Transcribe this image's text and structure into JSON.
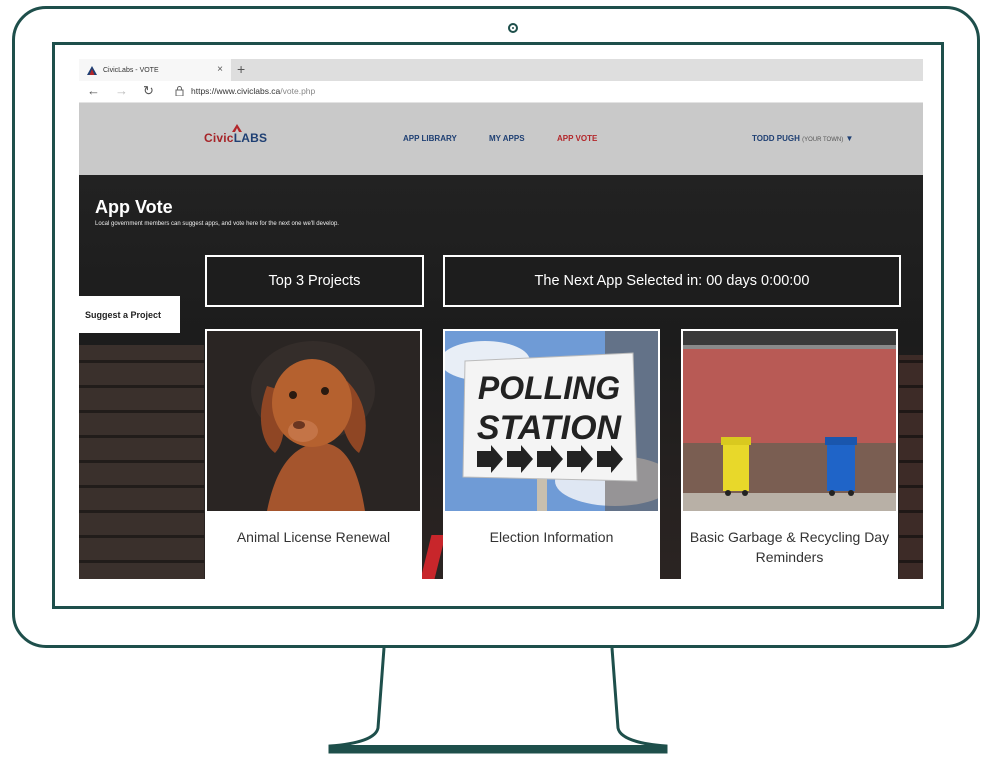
{
  "browser": {
    "tab_title": "CivicLabs - VOTE",
    "tab_close": "×",
    "new_tab": "+",
    "back": "←",
    "forward": "→",
    "reload": "↻",
    "url_host": "https://www.civiclabs.ca",
    "url_path": "/vote.php"
  },
  "header": {
    "brand_civic": "Civic",
    "brand_labs": "LABS",
    "nav": [
      {
        "label": "APP LIBRARY"
      },
      {
        "label": "MY APPS"
      },
      {
        "label": "APP VOTE"
      }
    ],
    "user_name": "TODD PUGH",
    "user_town": "(YOUR TOWN)",
    "user_caret": "▼"
  },
  "hero": {
    "title": "App Vote",
    "subtitle": "Local government members can suggest apps, and vote here for the next one we'll develop.",
    "top_projects": "Top 3 Projects",
    "countdown": "The Next App Selected in: 00 days 0:00:00",
    "suggest_button": "Suggest a Project"
  },
  "cards": [
    {
      "label": "Animal License Renewal"
    },
    {
      "label": "Election Information"
    },
    {
      "label": "Basic Garbage & Recycling Day Reminders"
    }
  ],
  "sign": {
    "line1": "POLLING",
    "line2": "STATION"
  },
  "colors": {
    "frame": "#1e4f4b",
    "brand_red": "#a62428",
    "brand_blue": "#1e3f73"
  }
}
